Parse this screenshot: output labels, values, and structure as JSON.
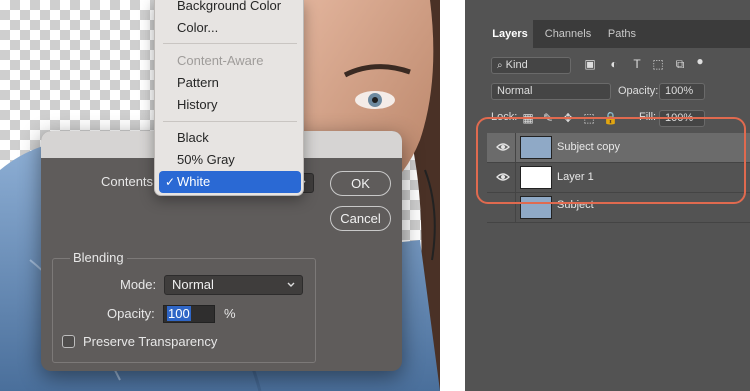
{
  "menu": {
    "items_top": [
      "Background Color",
      "Color..."
    ],
    "items_mid": [
      "Content-Aware",
      "Pattern",
      "History"
    ],
    "items_bottom": [
      "Black",
      "50% Gray",
      "White"
    ],
    "checkmark": "✓"
  },
  "dialog": {
    "contents_label": "Contents",
    "ok_label": "OK",
    "cancel_label": "Cancel",
    "blending_label": "Blending",
    "mode_label": "Mode:",
    "mode_value": "Normal",
    "opacity_label": "Opacity:",
    "opacity_value": "100",
    "percent": "%",
    "preserve_label": "Preserve Transparency"
  },
  "layers_panel": {
    "tabs": [
      "Layers",
      "Channels",
      "Paths"
    ],
    "kind_label": "Kind",
    "blend_mode": "Normal",
    "opacity_label": "Opacity:",
    "opacity_value": "100%",
    "lock_label": "Lock:",
    "fill_label": "Fill:",
    "fill_value": "100%",
    "layers": [
      {
        "name": "Subject copy",
        "visible": true,
        "selected": true
      },
      {
        "name": "Layer 1",
        "visible": true,
        "selected": false
      },
      {
        "name": "Subject",
        "visible": false,
        "selected": false
      }
    ]
  },
  "colors": {
    "highlight": "#e06a4f",
    "selection": "#2a69d4",
    "panel_bg": "#535353",
    "dialog_bg": "#5f5c5b"
  }
}
